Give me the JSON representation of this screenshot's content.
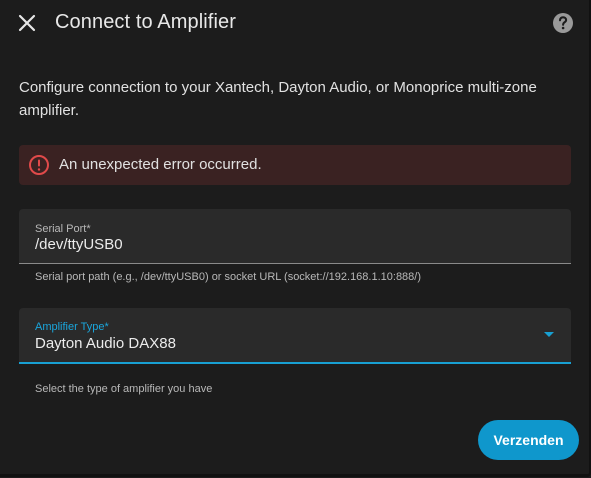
{
  "dialog": {
    "title": "Connect to Amplifier",
    "description": "Configure connection to your Xantech, Dayton Audio, or Monoprice multi-zone amplifier.",
    "close_icon": "close-icon",
    "help_icon": "help-circle-icon"
  },
  "error": {
    "icon": "alert-circle-icon",
    "message": "An unexpected error occurred.",
    "color": "#e04a4a"
  },
  "serial_port": {
    "label": "Serial Port*",
    "value": "/dev/ttyUSB0",
    "helper": "Serial port path (e.g., /dev/ttyUSB0) or socket URL (socket://192.168.1.10:888/)"
  },
  "amplifier_type": {
    "label": "Amplifier Type*",
    "value": "Dayton Audio DAX88",
    "helper": "Select the type of amplifier you have"
  },
  "actions": {
    "submit_label": "Verzenden"
  },
  "colors": {
    "accent": "#18a0d2",
    "background": "#1c1c1c",
    "field_bg": "#2a2a2a",
    "error_bg": "#3a2222"
  }
}
